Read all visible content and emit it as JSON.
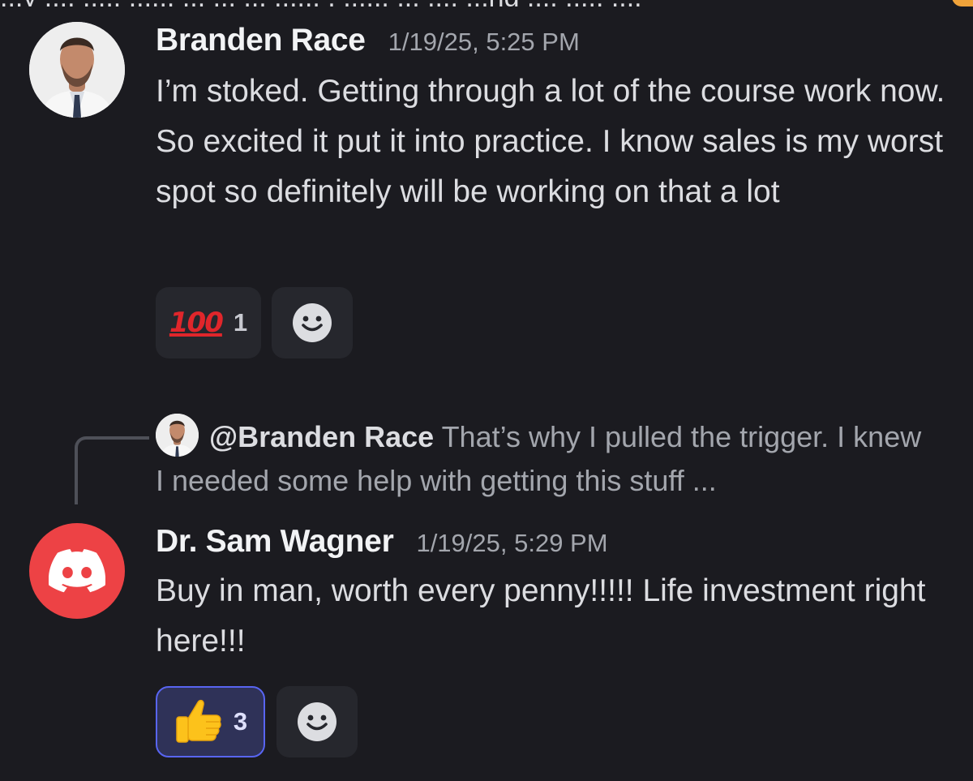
{
  "top_cutoff": {
    "text": "...y .... ..... ...... ... ...  ... ...... . ...... ... .... ...ng .... ..... ...."
  },
  "messages": [
    {
      "username": "Branden Race",
      "timestamp": "1/19/25, 5:25 PM",
      "body": "I’m stoked. Getting through a lot of the course work now. So excited it put it into practice. I know sales is my worst spot so definitely will be working on that a lot",
      "avatar": "profile-photo",
      "reactions": [
        {
          "emoji_icon": "hundred-points-emoji",
          "glyph": "100",
          "count": "1",
          "active": false
        }
      ],
      "add_reaction_icon": "smiley-add-reaction-icon"
    },
    {
      "reply": {
        "mention": "@Branden Race",
        "preview": "That’s why I pulled the trigger. I knew I needed some help with getting this stuff ..."
      },
      "username": "Dr. Sam Wagner",
      "timestamp": "1/19/25, 5:29 PM",
      "body": "Buy in man, worth every penny!!!!! Life investment right here!!!",
      "avatar": "discord-default-avatar",
      "reactions": [
        {
          "emoji_icon": "thumbs-up-emoji",
          "glyph": "👍",
          "count": "3",
          "active": true
        }
      ],
      "add_reaction_icon": "smiley-add-reaction-icon"
    }
  ],
  "colors": {
    "background": "#1b1b20",
    "discord_red": "#ed4245",
    "blurple": "#5865f2",
    "reaction_bg": "#26272d"
  }
}
